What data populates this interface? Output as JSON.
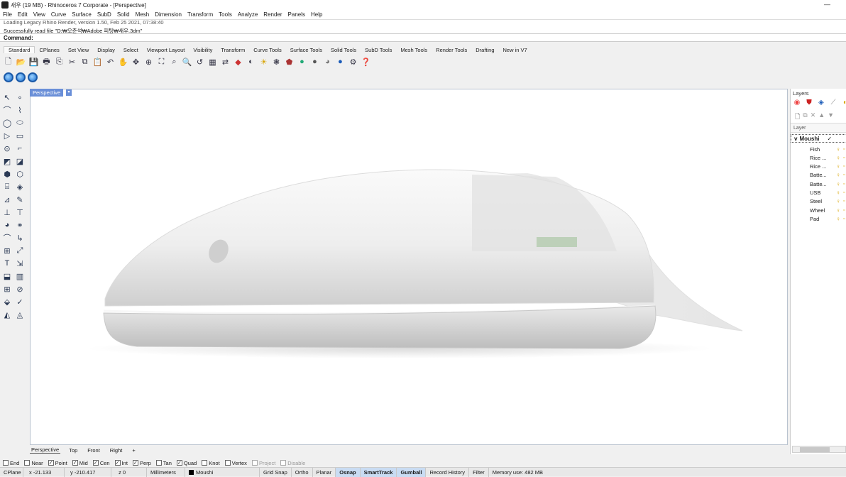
{
  "window": {
    "title": "새우 (19 MB) - Rhinoceros 7 Corporate - [Perspective]",
    "minimize_glyph": "—"
  },
  "menu": [
    "File",
    "Edit",
    "View",
    "Curve",
    "Surface",
    "SubD",
    "Solid",
    "Mesh",
    "Dimension",
    "Transform",
    "Tools",
    "Analyze",
    "Render",
    "Panels",
    "Help"
  ],
  "command_history": {
    "line1": "Loading Legacy Rhino Render, version 1.50, Feb 25 2021, 07:38:40",
    "line2": "Successfully read file \"D:₩오준석₩Adobe 피팅₩새우.3dm\""
  },
  "command_prompt": "Command:",
  "toolbar_tabs": [
    "Standard",
    "CPlanes",
    "Set View",
    "Display",
    "Select",
    "Viewport Layout",
    "Visibility",
    "Transform",
    "Curve Tools",
    "Surface Tools",
    "Solid Tools",
    "SubD Tools",
    "Mesh Tools",
    "Render Tools",
    "Drafting",
    "New in V7"
  ],
  "toolbar_icons": [
    "new-icon",
    "open-icon",
    "save-icon",
    "print-icon",
    "import-icon",
    "cut-icon",
    "copy-icon",
    "paste-icon",
    "undo-icon",
    "pan-icon",
    "rotate-view-icon",
    "zoom-extents-icon",
    "zoom-window-icon",
    "zoom-selected-icon",
    "zoom-icon",
    "undo-view-icon",
    "viewport-layout-icon",
    "move-cplane-icon",
    "shade-icon",
    "rendered-icon",
    "light-icon",
    "render-icon",
    "material-icon",
    "layer-icon",
    "properties-icon",
    "ghosted-icon",
    "environment-icon",
    "options-icon",
    "help-icon"
  ],
  "viewport": {
    "label": "Perspective",
    "tabs": [
      "Perspective",
      "Top",
      "Front",
      "Right"
    ],
    "active_tab": "Perspective",
    "add_tab_glyph": "+"
  },
  "layers": {
    "panel_title": "Layers",
    "column_header": "Layer",
    "parent": {
      "name": "Moushi",
      "check": "✓",
      "expander": "v"
    },
    "children": [
      "Fish",
      "Rice ...",
      "Rice ...",
      "Batte...",
      "Batte...",
      "USB",
      "Steel",
      "Wheel",
      "Pad"
    ],
    "bulb_glyph": "💡",
    "lock_glyph": "🔓"
  },
  "osnaps": [
    {
      "label": "End",
      "checked": false,
      "enabled": true
    },
    {
      "label": "Near",
      "checked": false,
      "enabled": true
    },
    {
      "label": "Point",
      "checked": true,
      "enabled": true
    },
    {
      "label": "Mid",
      "checked": true,
      "enabled": true
    },
    {
      "label": "Cen",
      "checked": true,
      "enabled": true
    },
    {
      "label": "Int",
      "checked": true,
      "enabled": true
    },
    {
      "label": "Perp",
      "checked": true,
      "enabled": true
    },
    {
      "label": "Tan",
      "checked": false,
      "enabled": true
    },
    {
      "label": "Quad",
      "checked": true,
      "enabled": true
    },
    {
      "label": "Knot",
      "checked": false,
      "enabled": true
    },
    {
      "label": "Vertex",
      "checked": false,
      "enabled": true
    },
    {
      "label": "Project",
      "checked": false,
      "enabled": false
    },
    {
      "label": "Disable",
      "checked": false,
      "enabled": false
    }
  ],
  "status": {
    "cplane": "CPlane",
    "x": "x -21.133",
    "y": "y -210.417",
    "z": "z 0",
    "units": "Millimeters",
    "layer": "Moushi",
    "grid_snap": "Grid Snap",
    "ortho": "Ortho",
    "planar": "Planar",
    "osnap": "Osnap",
    "smarttrack": "SmartTrack",
    "gumball": "Gumball",
    "record_history": "Record History",
    "filter": "Filter",
    "memory": "Memory use: 482 MB"
  },
  "colors": {
    "viewport_label_bg": "#6a8fd8",
    "active_toggle_bg": "#c9dcf3",
    "layer_color": "#000000"
  }
}
